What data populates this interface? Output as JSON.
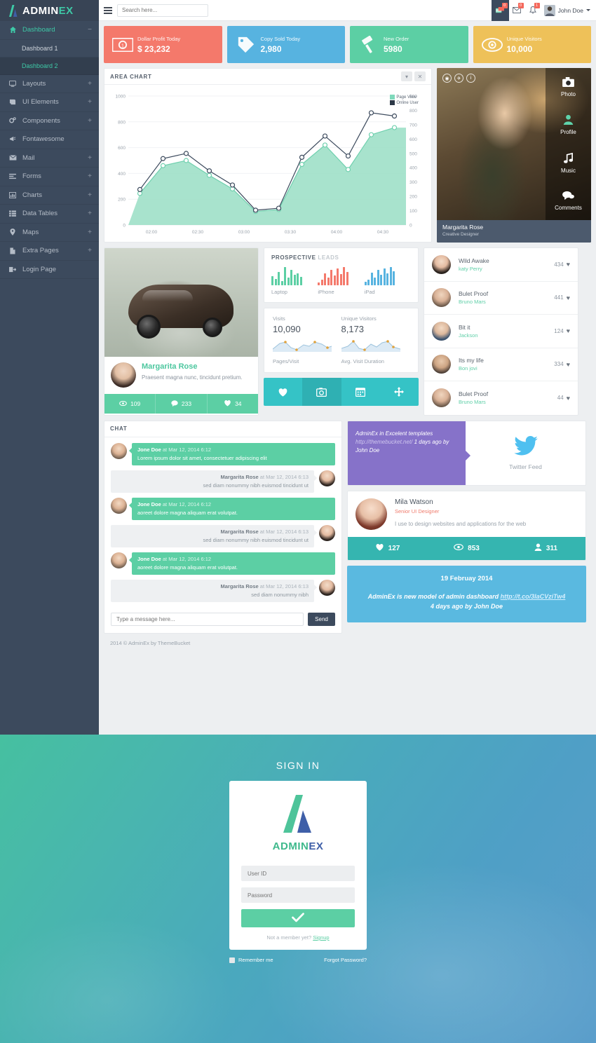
{
  "brand": {
    "name_main": "ADMIN",
    "name_accent": "EX",
    "logo_icon": "adminex-logo-icon"
  },
  "topbar": {
    "menu_toggle_icon": "hamburger-icon",
    "search_placeholder": "Search here...",
    "icons": [
      {
        "name": "messages-stack-icon",
        "glyph": "≡",
        "badge": "0"
      },
      {
        "name": "envelope-icon",
        "glyph": "✉",
        "badge": "0"
      },
      {
        "name": "bell-icon",
        "glyph": "🔔",
        "badge": "1"
      }
    ],
    "user_name": "John Doe",
    "caret_icon": "chevron-down-icon"
  },
  "sidebar": {
    "items": [
      {
        "label": "Dashboard",
        "icon": "home-icon",
        "glyph": "⌂",
        "expander": "−",
        "active": true
      },
      {
        "label": "Layouts",
        "icon": "monitor-icon",
        "glyph": "▭",
        "expander": "+"
      },
      {
        "label": "UI Elements",
        "icon": "book-icon",
        "glyph": "◨",
        "expander": "+"
      },
      {
        "label": "Components",
        "icon": "gears-icon",
        "glyph": "⚙",
        "expander": "+"
      },
      {
        "label": "Fontawesome",
        "icon": "megaphone-icon",
        "glyph": "◤",
        "expander": ""
      },
      {
        "label": "Mail",
        "icon": "envelope-icon",
        "glyph": "✉",
        "expander": "+"
      },
      {
        "label": "Forms",
        "icon": "form-icon",
        "glyph": "☰",
        "expander": "+"
      },
      {
        "label": "Charts",
        "icon": "chart-icon",
        "glyph": "▦",
        "expander": "+"
      },
      {
        "label": "Data Tables",
        "icon": "table-icon",
        "glyph": "☷",
        "expander": "+"
      },
      {
        "label": "Maps",
        "icon": "map-pin-icon",
        "glyph": "⚑",
        "expander": "+"
      },
      {
        "label": "Extra Pages",
        "icon": "file-icon",
        "glyph": "▯",
        "expander": "+"
      },
      {
        "label": "Login Page",
        "icon": "signin-icon",
        "glyph": "↳",
        "expander": ""
      }
    ],
    "sub_items": [
      {
        "label": "Dashboard 1",
        "selected": false
      },
      {
        "label": "Dashboard 2",
        "selected": true
      }
    ]
  },
  "stats": [
    {
      "title": "Dollar Profit Today",
      "value": "$ 23,232",
      "icon": "money-bill-icon",
      "glyph": "💵",
      "color": "#f4796b"
    },
    {
      "title": "Copy Sold Today",
      "value": "2,980",
      "icon": "price-tag-icon",
      "glyph": "🏷",
      "color": "#57b3e0"
    },
    {
      "title": "New Order",
      "value": "5980",
      "icon": "gavel-icon",
      "glyph": "🔨",
      "color": "#5ccfa4"
    },
    {
      "title": "Unique Visitors",
      "value": "10,000",
      "icon": "eye-icon",
      "glyph": "👁",
      "color": "#efc košt"
    }
  ],
  "area_panel": {
    "title": "AREA CHART",
    "collapse_icon": "chevron-down-icon",
    "close_icon": "close-icon"
  },
  "chart_data": {
    "type": "area",
    "title": "AREA CHART",
    "xlabel": "",
    "ylabel": "",
    "grid": true,
    "legend_position": "top-right",
    "x": [
      "01:50",
      "02:10",
      "02:25",
      "02:45",
      "03:00",
      "03:15",
      "03:35",
      "03:50",
      "04:05",
      "04:20",
      "04:40",
      "04:55"
    ],
    "xticks": [
      "02:00",
      "02:30",
      "03:00",
      "03:30",
      "04:00",
      "04:30"
    ],
    "yticks_left": [
      0,
      200,
      400,
      600,
      800,
      1000
    ],
    "ylim_left": [
      0,
      1000
    ],
    "yticks_right": [
      0,
      100,
      200,
      300,
      400,
      500,
      600,
      700,
      800,
      900
    ],
    "ylim_right": [
      0,
      900
    ],
    "series": [
      {
        "name": "Page View",
        "color": "#7fd9bb",
        "values": [
          245,
          460,
          500,
          385,
          280,
          105,
          120,
          470,
          620,
          430,
          700,
          755
        ]
      },
      {
        "name": "Online User",
        "color": "#3c4a5d",
        "values": [
          275,
          515,
          555,
          420,
          310,
          115,
          130,
          525,
          690,
          535,
          870,
          845
        ]
      }
    ]
  },
  "photo_card": {
    "socials": [
      {
        "name": "instagram-icon",
        "glyph": "◎"
      },
      {
        "name": "twitter-icon",
        "glyph": "✉"
      },
      {
        "name": "info-icon",
        "glyph": "i"
      }
    ],
    "menu": [
      {
        "label": "Photo",
        "icon": "camera-icon",
        "glyph": "📷"
      },
      {
        "label": "Profile",
        "icon": "user-icon",
        "glyph": "👤",
        "accent": true
      },
      {
        "label": "Music",
        "icon": "music-note-icon",
        "glyph": "♪"
      },
      {
        "label": "Comments",
        "icon": "comment-icon",
        "glyph": "💬"
      }
    ],
    "name": "Margarita Rose",
    "role": "Creative Designer"
  },
  "profile_card": {
    "image_alt": "concept-car-image",
    "name": "Margarita Rose",
    "description": "Praesent magna nunc, tincidunt pretium.",
    "stats": [
      {
        "icon": "eye-icon",
        "glyph": "👁",
        "value": "109"
      },
      {
        "icon": "comment-icon",
        "glyph": "💬",
        "value": "233"
      },
      {
        "icon": "heart-icon",
        "glyph": "♥",
        "value": "34"
      }
    ]
  },
  "leads": {
    "title_main": "PROSPECTIVE",
    "title_muted": "LEADS",
    "items": [
      {
        "label": "Laptop",
        "color": "#5ccfa4",
        "bars": [
          12,
          8,
          18,
          6,
          24,
          10,
          20,
          14,
          16,
          11
        ]
      },
      {
        "label": "iPhone",
        "color": "#f4796b",
        "bars": [
          4,
          7,
          16,
          10,
          20,
          13,
          22,
          15,
          24,
          18
        ]
      },
      {
        "label": "iPad",
        "color": "#57b3e0",
        "bars": [
          5,
          8,
          17,
          11,
          21,
          14,
          23,
          16,
          25,
          19
        ]
      }
    ]
  },
  "visits": {
    "left": {
      "title": "Visits",
      "value": "10,090",
      "sub": "Pages/Visit"
    },
    "right": {
      "title": "Unique Visitors",
      "value": "8,173",
      "sub": "Avg. Visit Duration"
    }
  },
  "icon_strip": [
    {
      "name": "heart-icon",
      "glyph": "♥",
      "active": false
    },
    {
      "name": "camera-icon",
      "glyph": "📷",
      "active": true
    },
    {
      "name": "calendar-icon",
      "glyph": "📅",
      "active": false
    },
    {
      "name": "move-icon",
      "glyph": "✥",
      "active": false
    }
  ],
  "songs": [
    {
      "title": "Wild Awake",
      "artist": "katy Perry",
      "likes": "434",
      "ava": "avatar-woman-1"
    },
    {
      "title": "Bulet Proof",
      "artist": "Bruno Mars",
      "likes": "441",
      "ava": "avatar-man-1"
    },
    {
      "title": "Bit it",
      "artist": "Jackson",
      "likes": "124",
      "ava": "avatar-man-2"
    },
    {
      "title": "Its my life",
      "artist": "Bon jovi",
      "likes": "334",
      "ava": "avatar-man-3"
    },
    {
      "title": "Bulet Proof",
      "artist": "Bruno Mars",
      "likes": "44",
      "ava": "avatar-man-4"
    }
  ],
  "chat": {
    "title": "CHAT",
    "messages": [
      {
        "side": "left",
        "who": "Jone Doe",
        "when": "at Mar 12, 2014 6:12",
        "text": "Lorem ipsum dolor sit amet, consectetuer adipiscing elit"
      },
      {
        "side": "right",
        "who": "Margarita Rose",
        "when": "at Mar 12, 2014 6:13",
        "text": "sed diam nonummy nibh euismod tincidunt ut"
      },
      {
        "side": "left",
        "who": "Jone Doe",
        "when": "at Mar 12, 2014 6:12",
        "text": "aoreet dolore magna aliquam erat volutpat."
      },
      {
        "side": "right",
        "who": "Margarita Rose",
        "when": "at Mar 12, 2014 6:13",
        "text": "sed diam nonummy nibh euismod tincidunt ut"
      },
      {
        "side": "left",
        "who": "Jone Doe",
        "when": "at Mar 12, 2014 6:12",
        "text": "aoreet dolore magna aliquam erat volutpat."
      },
      {
        "side": "right",
        "who": "Margarita Rose",
        "when": "at Mar 12, 2014 6:13",
        "text": "sed diam nonummy nibh"
      }
    ],
    "input_placeholder": "Type a message here...",
    "send_label": "Send"
  },
  "twitter": {
    "quote_pre": "AdminEx in Excelent templates ",
    "quote_link": "http://themebucket.net/",
    "quote_post": " 1 days ago by John Doe",
    "bird_icon": "twitter-bird-icon",
    "label": "Twitter Feed"
  },
  "person": {
    "name": "Mila Watson",
    "role": "Senior UI Designer",
    "description": "I use to design websites and applications for the web",
    "stats": [
      {
        "icon": "heart-icon",
        "glyph": "♥",
        "value": "127"
      },
      {
        "icon": "eye-icon",
        "glyph": "👁",
        "value": "853"
      },
      {
        "icon": "user-icon",
        "glyph": "👤",
        "value": "311"
      }
    ]
  },
  "notice": {
    "date": "19 Februay 2014",
    "text_pre": "AdminEx is new model of admin dashboard ",
    "link": "http://t.co/3IaCVziTw4",
    "text_post": "4 days ago by John Doe"
  },
  "footer": {
    "text": "2014 © AdminEx by ThemeBucket"
  },
  "login": {
    "title": "SIGN IN",
    "logo_icon": "adminex-logo-icon",
    "brand_main": "ADMIN",
    "brand_accent": "EX",
    "userid_placeholder": "User ID",
    "password_placeholder": "Password",
    "submit_icon": "check-icon",
    "submit_glyph": "✔",
    "foot_text": "Not a member yet? ",
    "signup_label": "Signup",
    "remember_label": "Remember me",
    "forgot_label": "Forgot Password?"
  }
}
